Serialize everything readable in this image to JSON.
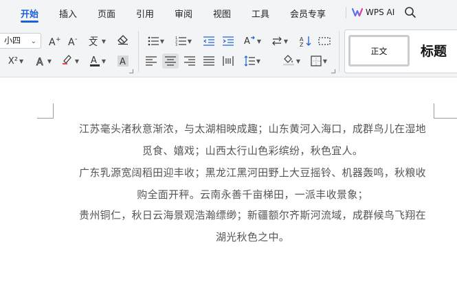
{
  "menu": {
    "tabs": [
      {
        "label": "开始",
        "active": true
      },
      {
        "label": "插入"
      },
      {
        "label": "页面"
      },
      {
        "label": "引用"
      },
      {
        "label": "审阅"
      },
      {
        "label": "视图"
      },
      {
        "label": "工具"
      },
      {
        "label": "会员专享"
      }
    ],
    "wps_ai_label": "WPS AI",
    "accent_color": "#1a5fd8"
  },
  "ribbon": {
    "font_size": "小四",
    "icons": {
      "grow_font": "A⁺",
      "shrink_font": "A⁻",
      "phonetic": "ú",
      "clear_format": "eraser-icon",
      "superscript": "X²",
      "text_effect": "A",
      "highlight": "highlighter-icon",
      "font_color": "A",
      "char_shading": "A"
    },
    "styles": {
      "normal": "正文",
      "heading": "标题"
    }
  },
  "document": {
    "paragraphs": [
      {
        "lines": [
          "江苏毫头渚秋意渐浓，与太湖相映成趣；山东黄河入海口，成群鸟儿在湿地",
          "觅食、嬉戏；山西太行山色彩缤纷，秋色宜人。"
        ]
      },
      {
        "lines": [
          "广东乳源宽阔稻田迎丰收；黑龙江黑河田野上大豆摇铃、机器轰鸣，秋粮收",
          "购全面开秤。云南永善千亩梯田，一派丰收景象；"
        ]
      },
      {
        "lines": [
          "贵州铜仁，秋日云海景观浩瀚缥缈；新疆额尔齐斯河流域，成群候鸟飞翔在",
          "湖光秋色之中。"
        ]
      }
    ]
  }
}
